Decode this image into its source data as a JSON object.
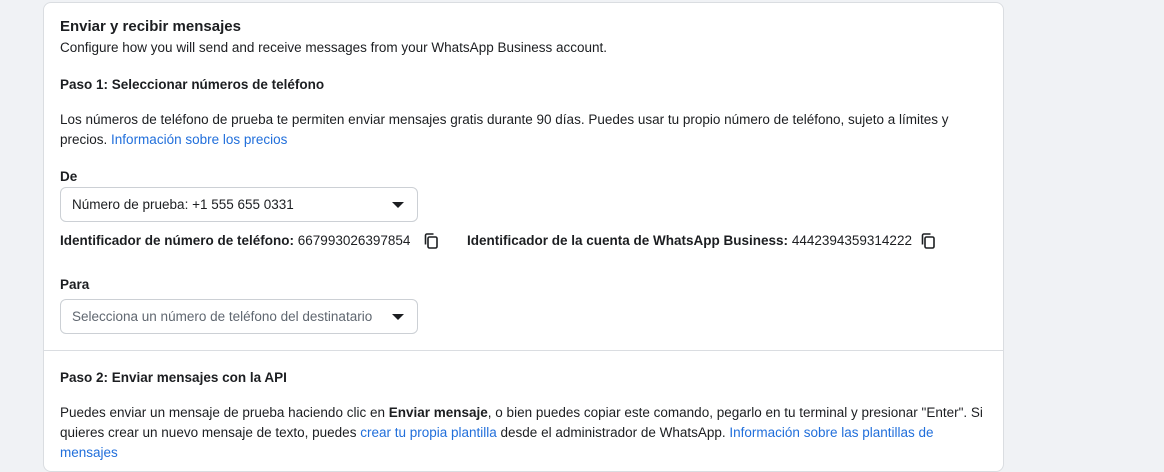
{
  "section1": {
    "title": "Enviar y recibir mensajes",
    "subtitle": "Configure how you will send and receive messages from your WhatsApp Business account.",
    "step1_title": "Paso 1: Seleccionar números de teléfono",
    "step1_text": "Los números de teléfono de prueba te permiten enviar mensajes gratis durante 90 días. Puedes usar tu propio número de teléfono, sujeto a límites y precios.",
    "pricing_link": "Información sobre los precios",
    "from_label": "De",
    "from_value": "Número de prueba: +1 555 655 0331",
    "phone_id_label": "Identificador de número de teléfono:",
    "phone_id_value": "667993026397854",
    "waba_id_label": "Identificador de la cuenta de WhatsApp Business:",
    "waba_id_value": "4442394359314222",
    "to_label": "Para",
    "to_placeholder": "Selecciona un número de teléfono del destinatario"
  },
  "section2": {
    "step2_title": "Paso 2: Enviar mensajes con la API",
    "text_a": "Puedes enviar un mensaje de prueba haciendo clic en ",
    "text_bold": "Enviar mensaje",
    "text_b": ", o bien puedes copiar este comando, pegarlo en tu terminal y presionar \"Enter\". Si quieres crear un nuevo mensaje de texto, puedes ",
    "template_link": "crear tu propia plantilla",
    "text_c": " desde el administrador de WhatsApp. ",
    "templates_info_link": "Información sobre las plantillas de mensajes"
  },
  "icons": {
    "copy": "copy-icon",
    "dropdown": "caret-down-icon"
  },
  "colors": {
    "link": "#216fdb",
    "text": "#1c1e21",
    "border": "#ccd0d5",
    "background": "#f0f2f5"
  }
}
